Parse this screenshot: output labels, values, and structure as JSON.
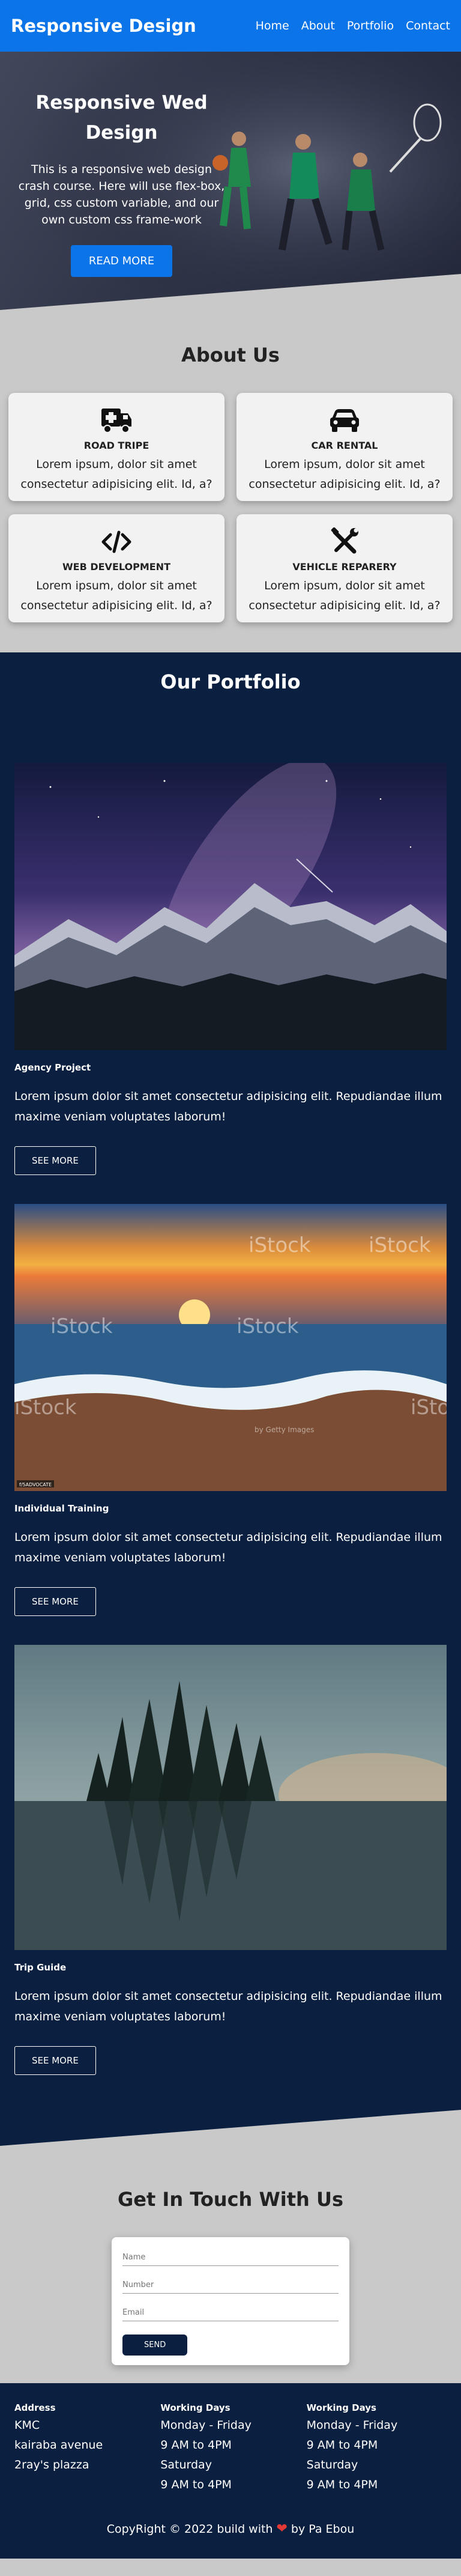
{
  "header": {
    "brand": "Responsive Design",
    "nav": [
      "Home",
      "About",
      "Portfolio",
      "Contact"
    ]
  },
  "hero": {
    "title_line1": "Responsive Wed",
    "title_line2": "Design",
    "description": "This is a responsive web design crash course. Here will use flex-box, grid, css custom variable, and our own custom css frame-work",
    "button": "READ MORE"
  },
  "about": {
    "title": "About Us",
    "cards": [
      {
        "icon": "truck-medical-icon",
        "title": "ROAD TRIPE",
        "text": "Lorem ipsum, dolor sit amet consectetur adipisicing elit. Id, a?"
      },
      {
        "icon": "car-icon",
        "title": "CAR RENTAL",
        "text": "Lorem ipsum, dolor sit amet consectetur adipisicing elit. Id, a?"
      },
      {
        "icon": "code-icon",
        "title": "WEB DEVELOPMENT",
        "text": "Lorem ipsum, dolor sit amet consectetur adipisicing elit. Id, a?"
      },
      {
        "icon": "tools-icon",
        "title": "VEHICLE REPARERY",
        "text": "Lorem ipsum, dolor sit amet consectetur adipisicing elit. Id, a?"
      }
    ]
  },
  "portfolio": {
    "title": "Our Portfolio",
    "items": [
      {
        "image": "mountain-night-sky-image",
        "title": "Agency Project",
        "text": "Lorem ipsum dolor sit amet consectetur adipisicing elit. Repudiandae illum maxime veniam voluptates laborum!",
        "button": "SEE MORE"
      },
      {
        "image": "beach-sunset-image",
        "title": "Individual Training",
        "text": "Lorem ipsum dolor sit amet consectetur adipisicing elit. Repudiandae illum maxime veniam voluptates laborum!",
        "button": "SEE MORE",
        "watermark": "iStock",
        "watermark_sub": "by Getty Images",
        "credit": "f/5ADVOCATE"
      },
      {
        "image": "lake-forest-image",
        "title": "Trip Guide",
        "text": "Lorem ipsum dolor sit amet consectetur adipisicing elit. Repudiandae illum maxime veniam voluptates laborum!",
        "button": "SEE MORE"
      }
    ]
  },
  "contact": {
    "title": "Get In Touch With Us",
    "name_placeholder": "Name",
    "number_placeholder": "Number",
    "email_placeholder": "Email",
    "button": "SEND"
  },
  "footer": {
    "columns": [
      {
        "heading": "Address",
        "lines": [
          "KMC",
          "kairaba avenue",
          "2ray's plazza"
        ]
      },
      {
        "heading": "Working Days",
        "lines": [
          "Monday - Friday",
          "9 AM to 4PM",
          "Saturday",
          "9 AM to 4PM"
        ]
      },
      {
        "heading": "Working Days",
        "lines": [
          "Monday - Friday",
          "9 AM to 4PM",
          "Saturday",
          "9 AM to 4PM"
        ]
      }
    ],
    "copyright_pre": "CopyRight © 2022 build with",
    "copyright_post": "by Pa Ebou"
  },
  "colors": {
    "primary": "#0b74e8",
    "navy": "#0b2040",
    "gray": "#c9c9c9",
    "heart": "#e53935"
  }
}
